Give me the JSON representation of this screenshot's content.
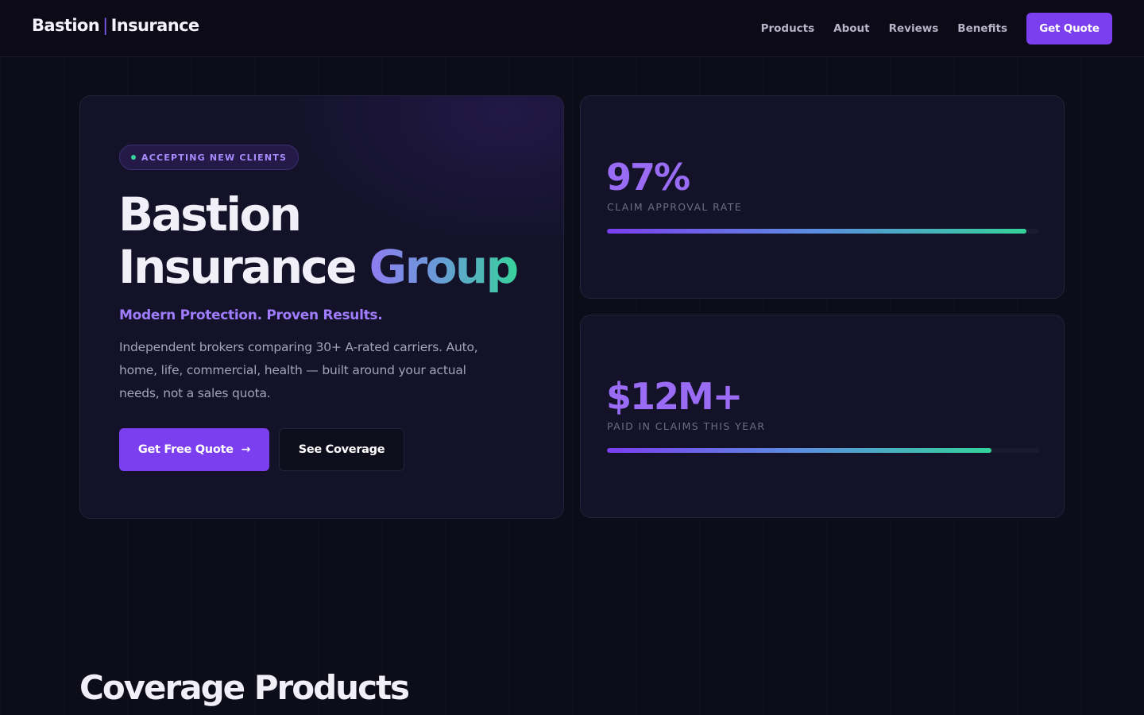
{
  "header": {
    "brand_left": "Bastion",
    "brand_sep": "|",
    "brand_right": "Insurance",
    "nav": [
      "Products",
      "About",
      "Reviews",
      "Benefits"
    ],
    "cta_label": "Get Quote"
  },
  "hero": {
    "badge": "ACCEPTING NEW CLIENTS",
    "title_line1": "Bastion",
    "title_line2a": "Insurance",
    "title_line2b": "Group",
    "tagline": "Modern Protection. Proven Results.",
    "description": "Independent brokers comparing 30+ A-rated carriers. Auto, home, life, commercial, health — built around your actual needs, not a sales quota.",
    "primary_button": "Get Free Quote",
    "secondary_button": "See Coverage"
  },
  "stats": [
    {
      "value": "97%",
      "label": "CLAIM APPROVAL RATE",
      "progress": 0.97
    },
    {
      "value": "$12M+",
      "label": "PAID IN CLAIMS THIS YEAR",
      "progress": 0.89
    }
  ],
  "colors": {
    "accent": "#7b3ff0",
    "accent_light": "#a07cff",
    "success": "#34d39a",
    "background": "#0d0c19",
    "card": "#131228"
  },
  "sections": {
    "products_title": "Coverage Products"
  }
}
